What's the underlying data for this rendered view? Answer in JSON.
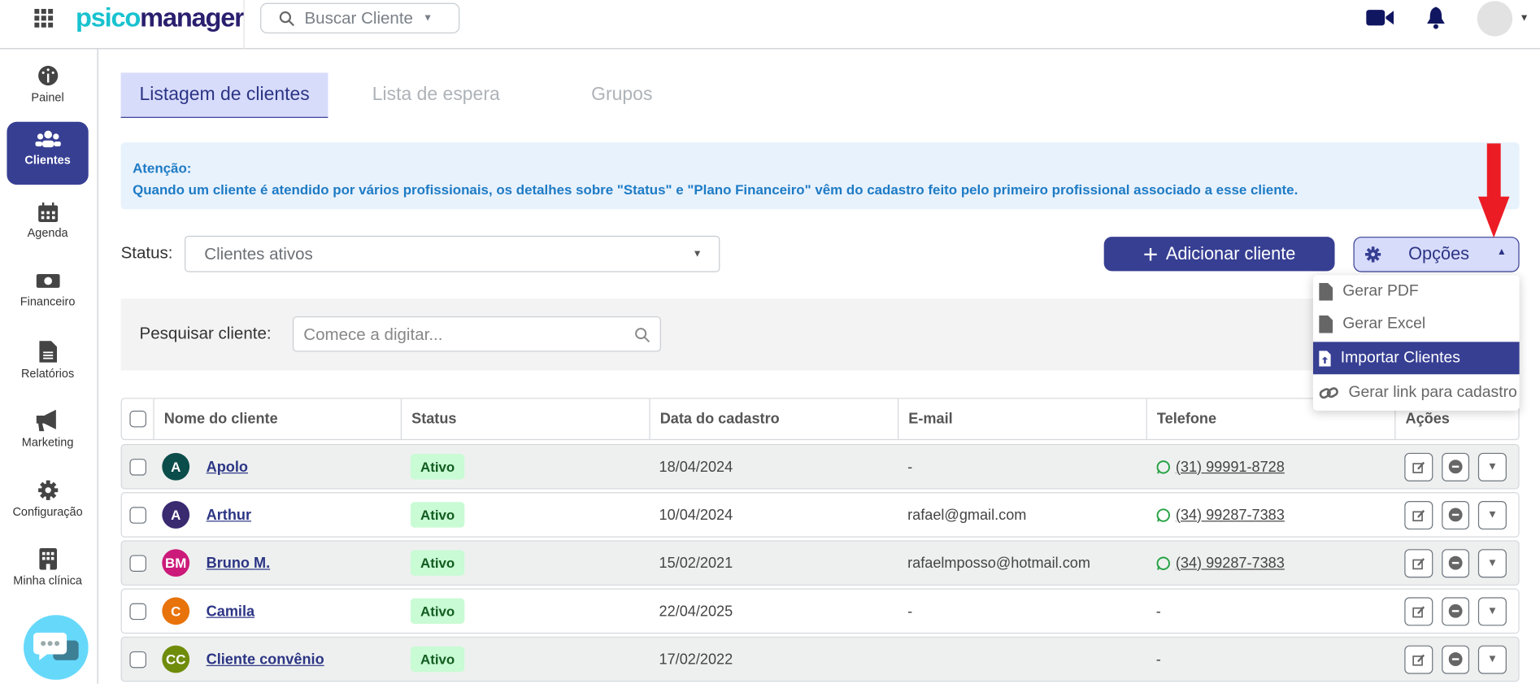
{
  "header": {
    "logo_part1": "psico",
    "logo_part2": "manager",
    "search_label": "Buscar Cliente"
  },
  "sidebar": {
    "items": [
      {
        "label": "Painel"
      },
      {
        "label": "Clientes"
      },
      {
        "label": "Agenda"
      },
      {
        "label": "Financeiro"
      },
      {
        "label": "Relatórios"
      },
      {
        "label": "Marketing"
      },
      {
        "label": "Configuração"
      },
      {
        "label": "Minha clínica"
      }
    ]
  },
  "tabs": [
    {
      "label": "Listagem de clientes"
    },
    {
      "label": "Lista de espera"
    },
    {
      "label": "Grupos"
    }
  ],
  "alert": {
    "title": "Atenção:",
    "message": "Quando um cliente é atendido por vários profissionais, os detalhes sobre \"Status\" e \"Plano Financeiro\" vêm do cadastro feito pelo primeiro profissional associado a esse cliente."
  },
  "filters": {
    "status_label": "Status:",
    "status_value": "Clientes ativos",
    "search_label": "Pesquisar cliente:",
    "search_placeholder": "Comece a digitar..."
  },
  "buttons": {
    "add": "Adicionar cliente",
    "options": "Opções"
  },
  "options_menu": [
    {
      "label": "Gerar PDF"
    },
    {
      "label": "Gerar Excel"
    },
    {
      "label": "Importar Clientes"
    },
    {
      "label": "Gerar link para cadastro"
    }
  ],
  "table": {
    "headers": [
      "Nome do cliente",
      "Status",
      "Data do cadastro",
      "E-mail",
      "Telefone",
      "Ações"
    ],
    "rows": [
      {
        "initials": "A",
        "color": "#0b4d4b",
        "name": "Apolo",
        "status": "Ativo",
        "date": "18/04/2024",
        "email": "-",
        "phone": "(31) 99991-8728"
      },
      {
        "initials": "A",
        "color": "#3a2a70",
        "name": "Arthur",
        "status": "Ativo",
        "date": "10/04/2024",
        "email": "rafael@gmail.com",
        "phone": "(34) 99287-7383"
      },
      {
        "initials": "BM",
        "color": "#cc1a7a",
        "name": "Bruno M.",
        "status": "Ativo",
        "date": "15/02/2021",
        "email": "rafaelmposso@hotmail.com",
        "phone": "(34) 99287-7383"
      },
      {
        "initials": "C",
        "color": "#e8730a",
        "name": "Camila",
        "status": "Ativo",
        "date": "22/04/2025",
        "email": "-",
        "phone": "-"
      },
      {
        "initials": "CC",
        "color": "#6f8c0b",
        "name": "Cliente convênio",
        "status": "Ativo",
        "date": "17/02/2022",
        "email": "",
        "phone": "-"
      }
    ]
  }
}
